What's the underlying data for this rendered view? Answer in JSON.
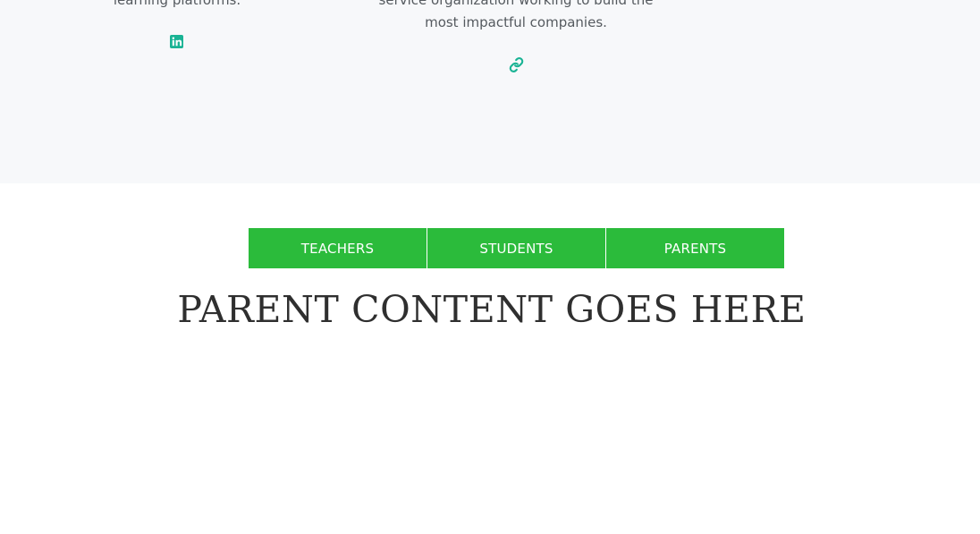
{
  "team": {
    "member_1": {
      "bio_lines": [
        "learning platforms."
      ],
      "social_icon": "linkedin-icon"
    },
    "member_2": {
      "bio_lines": [
        "service organization working to build the",
        "most impactful companies."
      ],
      "social_icon": "link-icon"
    }
  },
  "tabs": [
    {
      "label": "TEACHERS"
    },
    {
      "label": "STUDENTS"
    },
    {
      "label": "PARENTS"
    }
  ],
  "content": {
    "heading": "PARENT CONTENT GOES HERE"
  },
  "colors": {
    "tab_background": "#2bbb3b",
    "icon_accent": "#1ab394",
    "section_background": "#f7f8fa"
  }
}
